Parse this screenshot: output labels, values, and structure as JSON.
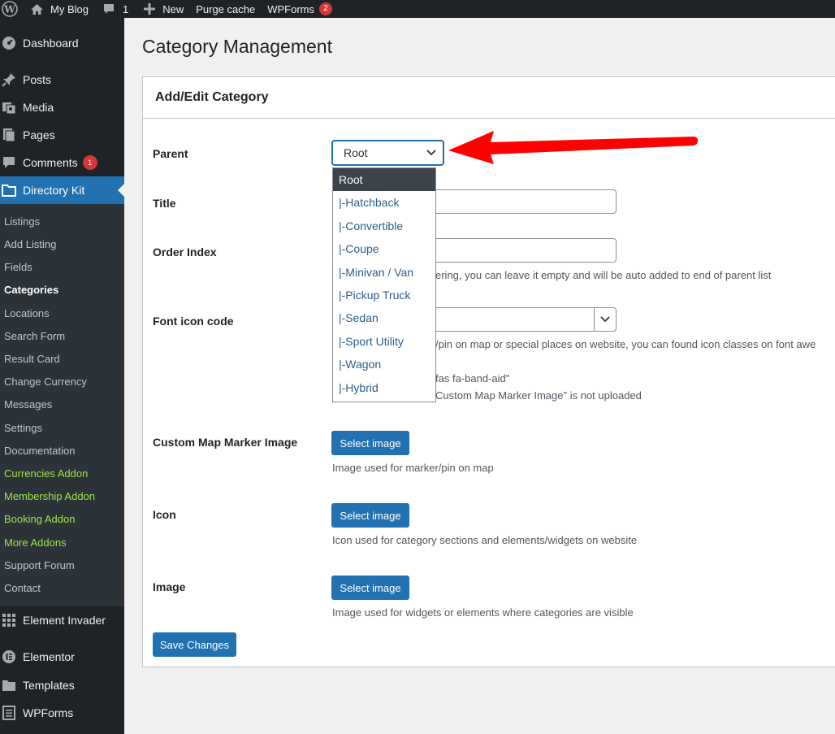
{
  "adminbar": {
    "site_name": "My Blog",
    "comments_count": "1",
    "new_label": "New",
    "purge_label": "Purge cache",
    "wpforms_label": "WPForms",
    "wpforms_badge": "2"
  },
  "sidebar": {
    "dashboard": "Dashboard",
    "posts": "Posts",
    "media": "Media",
    "pages": "Pages",
    "comments": "Comments",
    "comments_badge": "1",
    "directory_kit": "Directory Kit",
    "submenu": [
      "Listings",
      "Add Listing",
      "Fields",
      "Categories",
      "Locations",
      "Search Form",
      "Result Card",
      "Change Currency",
      "Messages",
      "Settings",
      "Documentation",
      "Currencies Addon",
      "Membership Addon",
      "Booking Addon",
      "More Addons",
      "Support Forum",
      "Contact"
    ],
    "element_invader": "Element Invader",
    "elementor": "Elementor",
    "templates": "Templates",
    "wpforms": "WPForms"
  },
  "page": {
    "title": "Category Management",
    "box_title": "Add/Edit Category"
  },
  "form": {
    "parent_label": "Parent",
    "parent_value": "Root",
    "parent_options": [
      "Root",
      "|-Hatchback",
      "|-Convertible",
      "|-Coupe",
      "|-Minivan / Van",
      "|-Pickup Truck",
      "|-Sedan",
      "|-Sport Utility",
      "|-Wagon",
      "|-Hybrid"
    ],
    "title_label": "Title",
    "order_label": "Order Index",
    "order_desc": "ering, you can leave it empty and will be auto added to end of parent list",
    "font_icon_label": "Font icon code",
    "font_icon_desc": "/pin on map or special places on website, you can found icon classes on font awe",
    "font_icon_example": "fas fa-band-aid\"",
    "font_icon_note": "Custom Map Marker Image\" is not uploaded",
    "marker_label": "Custom Map Marker Image",
    "marker_desc": "Image used for marker/pin on map",
    "icon_label": "Icon",
    "icon_desc": "Icon used for category sections and elements/widgets on website",
    "image_label": "Image",
    "image_desc": "Image used for widgets or elements where categories are visible",
    "select_image": "Select image",
    "save": "Save Changes"
  },
  "colors": {
    "admin_dark": "#1d2327",
    "submenu_bg": "#2c3338",
    "accent_blue": "#2271b1",
    "addon_green": "#9ee54a",
    "badge_red": "#d63638",
    "arrow_red": "#ff0000"
  }
}
